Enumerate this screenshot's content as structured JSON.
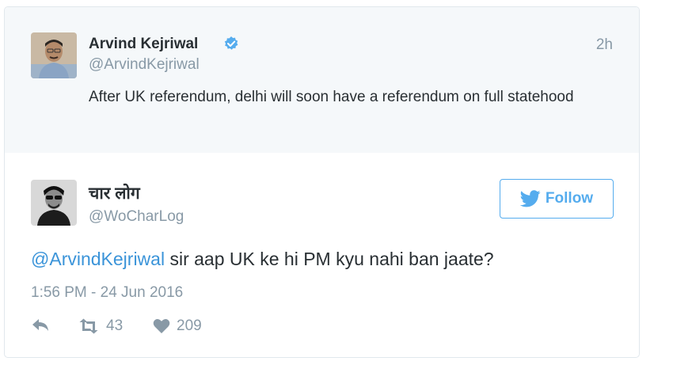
{
  "parent_tweet": {
    "name": "Arvind Kejriwal",
    "handle": "@ArvindKejriwal",
    "verified": true,
    "time_ago": "2h",
    "text": "After UK referendum, delhi will soon have a referendum on full statehood"
  },
  "reply_tweet": {
    "name": "चार लोग",
    "handle": "@WoCharLog",
    "follow_label": "Follow",
    "mention": "@ArvindKejriwal",
    "text": " sir aap UK ke hi PM kyu nahi ban jaate?",
    "timestamp": "1:56 PM - 24 Jun 2016",
    "retweets": "43",
    "likes": "209"
  },
  "colors": {
    "accent": "#55acee",
    "link": "#3b94d9",
    "muted": "#8899a6",
    "text": "#292f33",
    "parent_bg": "#f5f8fa"
  },
  "icons": [
    "verified-badge-icon",
    "twitter-bird-icon",
    "reply-icon",
    "retweet-icon",
    "heart-icon"
  ]
}
